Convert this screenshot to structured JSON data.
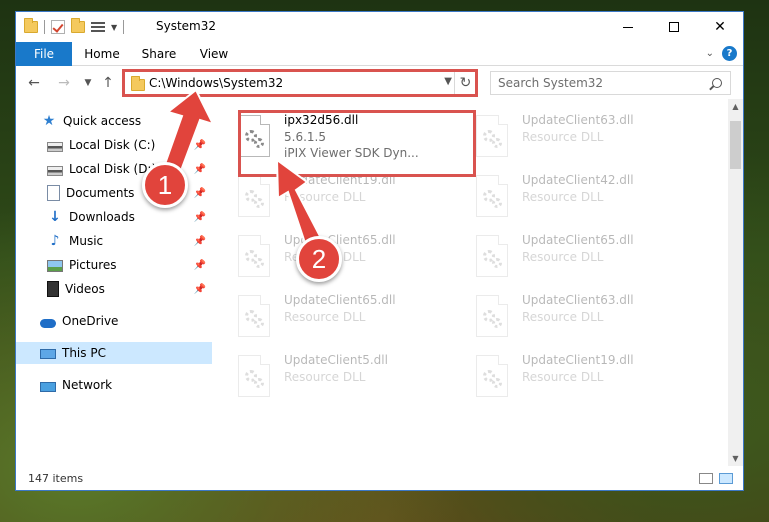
{
  "window": {
    "title": "System32",
    "controls": {
      "minimize": "",
      "maximize": "",
      "close": "✕"
    }
  },
  "ribbon": {
    "tabs": [
      "File",
      "Home",
      "Share",
      "View"
    ],
    "help": "?"
  },
  "address": {
    "path": "C:\\Windows\\System32",
    "search_placeholder": "Search System32"
  },
  "sidebar": {
    "items": [
      {
        "label": "Quick access",
        "icon": "star-icon"
      },
      {
        "label": "Local Disk (C:)",
        "icon": "drive-icon",
        "pinned": true
      },
      {
        "label": "Local Disk (D:)",
        "icon": "drive-icon",
        "pinned": true
      },
      {
        "label": "Documents",
        "icon": "documents-icon",
        "pinned": true
      },
      {
        "label": "Downloads",
        "icon": "downloads-icon",
        "pinned": true
      },
      {
        "label": "Music",
        "icon": "music-icon",
        "pinned": true
      },
      {
        "label": "Pictures",
        "icon": "pictures-icon",
        "pinned": true
      },
      {
        "label": "Videos",
        "icon": "videos-icon",
        "pinned": true
      },
      {
        "label": "OneDrive",
        "icon": "cloud-icon"
      },
      {
        "label": "This PC",
        "icon": "computer-icon",
        "selected": true
      },
      {
        "label": "Network",
        "icon": "network-icon"
      }
    ]
  },
  "files": [
    {
      "name": "ipx32d56.dll",
      "line2": "5.6.1.5",
      "line3": "iPIX Viewer SDK Dyn..."
    },
    {
      "name": "UpdateClient63.dll",
      "line2": "Resource DLL"
    },
    {
      "name": "UpdateClient19.dll",
      "line2": "Resource DLL"
    },
    {
      "name": "UpdateClient42.dll",
      "line2": "Resource DLL"
    },
    {
      "name": "UpdateClient65.dll",
      "line2": "Resource DLL"
    },
    {
      "name": "UpdateClient65.dll",
      "line2": "Resource DLL"
    },
    {
      "name": "UpdateClient65.dll",
      "line2": "Resource DLL"
    },
    {
      "name": "UpdateClient63.dll",
      "line2": "Resource DLL"
    },
    {
      "name": "UpdateClient5.dll",
      "line2": "Resource DLL"
    },
    {
      "name": "UpdateClient19.dll",
      "line2": "Resource DLL"
    }
  ],
  "status": {
    "count": "147 items"
  },
  "callouts": [
    "1",
    "2"
  ],
  "colors": {
    "accent": "#1979ca",
    "highlight": "#d9534f",
    "selected": "#cce8ff"
  }
}
